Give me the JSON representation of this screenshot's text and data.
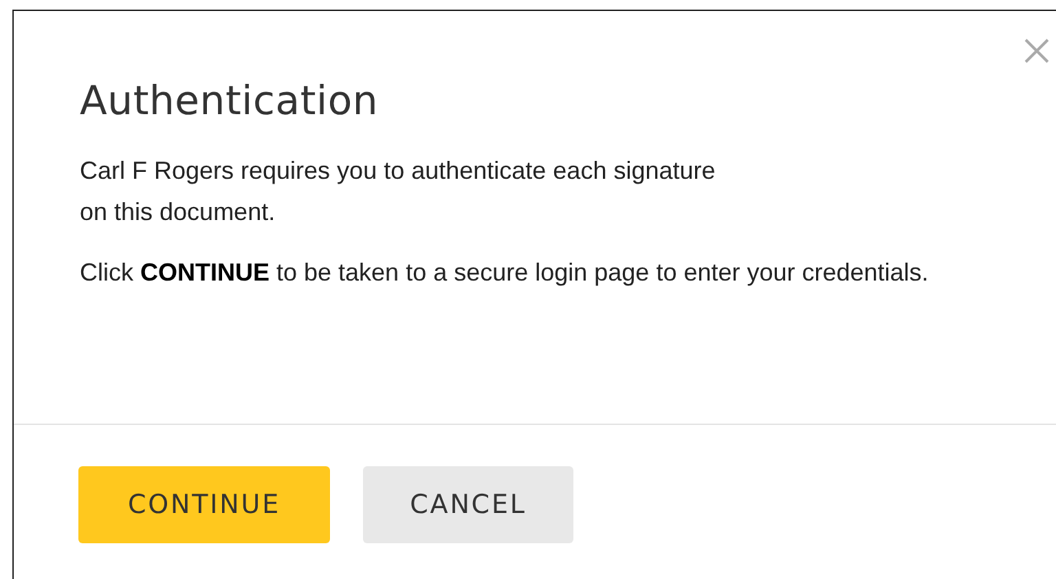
{
  "dialog": {
    "title": "Authentication",
    "paragraphs": [
      "Carl F Rogers requires you to authenticate each signature\non this document.",
      "Click **CONTINUE** to be taken to a secure login page to enter your credentials."
    ],
    "buttons": [
      {
        "label": "CONTINUE",
        "kind": "primary"
      },
      {
        "label": "CANCEL",
        "kind": "secondary"
      }
    ]
  }
}
